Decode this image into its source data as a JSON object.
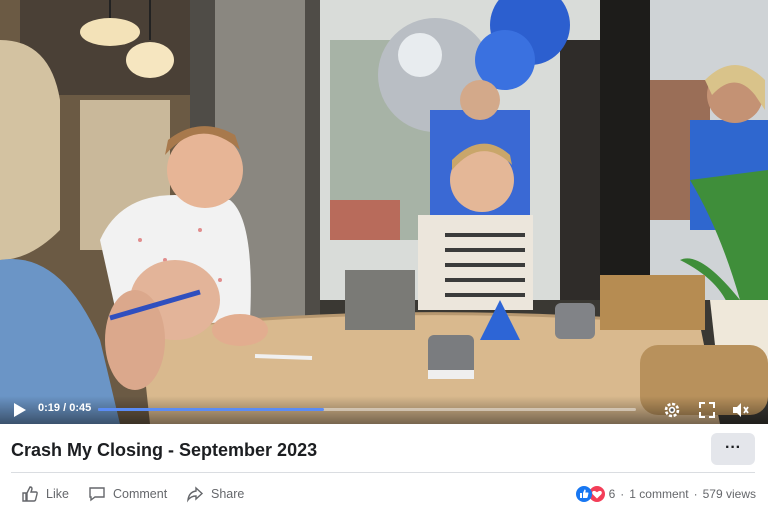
{
  "video": {
    "current_time": "0:19",
    "duration": "0:45",
    "time_separator": " / ",
    "progress_fraction": 0.42
  },
  "post": {
    "title": "Crash My Closing - September 2023",
    "more_label": "···"
  },
  "actions": {
    "like": "Like",
    "comment": "Comment",
    "share": "Share"
  },
  "stats": {
    "reaction_count": "6",
    "comments": "1 comment",
    "views": "579 views",
    "separator": "·"
  },
  "colors": {
    "progress": "#5b8cf5",
    "like_blue": "#1877f2",
    "love_red": "#f33e58"
  },
  "icons": [
    "play-icon",
    "settings-icon",
    "fullscreen-icon",
    "volume-icon",
    "like-icon",
    "comment-icon",
    "share-icon"
  ]
}
